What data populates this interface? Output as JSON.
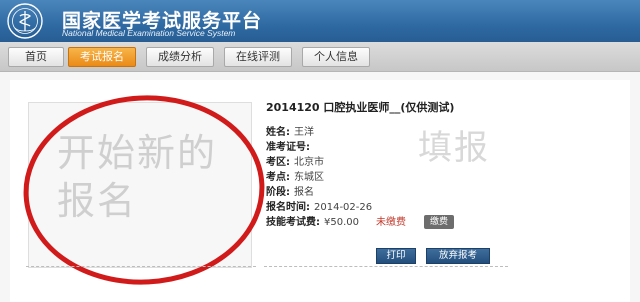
{
  "header": {
    "title": "国家医学考试服务平台",
    "subtitle": "National Medical Examination Service System",
    "logo_icon": "medical-exam-seal-logo"
  },
  "nav": {
    "items": [
      {
        "label": "首页",
        "active": false
      },
      {
        "label": "考试报名",
        "active": true
      },
      {
        "label": "成绩分析",
        "active": false
      },
      {
        "label": "在线评测",
        "active": false
      },
      {
        "label": "个人信息",
        "active": false
      }
    ]
  },
  "new_registration": {
    "label": "开始新的报名",
    "annotation_color": "#d11a1a"
  },
  "registration": {
    "exam_title": "2014120 口腔执业医师__(仅供测试)",
    "watermark": "填报",
    "fields": [
      {
        "label": "姓名:",
        "value": "王洋"
      },
      {
        "label": "准考证号:",
        "value": ""
      },
      {
        "label": "考区:",
        "value": "北京市"
      },
      {
        "label": "考点:",
        "value": "东城区"
      },
      {
        "label": "阶段:",
        "value": "报名"
      },
      {
        "label": "报名时间:",
        "value": "2014-02-26"
      },
      {
        "label": "技能考试费:",
        "value": "¥50.00"
      }
    ],
    "fee_status": "未缴费",
    "pay_button": "缴费",
    "print_button": "打印",
    "abandon_button": "放弃报考"
  },
  "colors": {
    "header_blue": "#2f6aa3",
    "nav_active_orange": "#ea8a17",
    "unpaid_red": "#c0392b",
    "button_navy": "#234f7d"
  }
}
